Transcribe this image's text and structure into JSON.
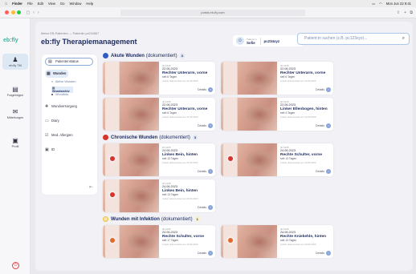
{
  "menubar": {
    "items": [
      "Finder",
      "File",
      "Edit",
      "View",
      "Go",
      "Window",
      "Help"
    ],
    "clock": "Mon Jun 22  9:41"
  },
  "browser": {
    "url": "portal.eb-fly.com"
  },
  "rail": {
    "logo_main": "eb:fly",
    "items": [
      {
        "label": "eb:fly TM"
      },
      {
        "label": "Fragebögen"
      },
      {
        "label": "Mitteilungen"
      },
      {
        "label": "Profil"
      }
    ]
  },
  "header": {
    "breadcrumb": "Meine EB-Patienten  →  Patientin pc234567",
    "title": "eb:fly Therapiemanagement",
    "user_caption": "Patient:in",
    "user_name": "Sofie",
    "user_id": "pc234xyz",
    "search_placeholder": "Patient:in suchen (z.B. pc123xyz)..."
  },
  "panel": {
    "status": "Patientenstatus",
    "wunden": "Wunden",
    "sub1": "Aktive Wunden",
    "sub2": "Wundarchiv",
    "sub3": "Wundfoto",
    "versorgung": "Wundversorgung",
    "diary": "Diary",
    "allergien": "Med. Allergien",
    "id": "ID"
  },
  "sections": {
    "akute": {
      "label": "Akute Wunden",
      "sub": "(dokumentiert)",
      "count": "3"
    },
    "chronische": {
      "label": "Chronische Wunden",
      "sub": "(dokumentiert)",
      "count": "3"
    },
    "infektion": {
      "label": "Wunden mit Infektion",
      "sub": "(dokumentiert)",
      "count": "1"
    }
  },
  "cards": [
    {
      "id": "ID 1235",
      "date": "22.06.2023",
      "loc": "Rechter Unterarm, vorne",
      "since": "seit 6 Tagen",
      "doc": "zuletzt dokumentiert am 22.06.2023",
      "details": "Details"
    },
    {
      "id": "ID 1235",
      "date": "22.06.2023",
      "loc": "Rechter Unterarm, vorne",
      "since": "seit 6 Tagen",
      "doc": "zuletzt dokumentiert am 22.06.2023",
      "details": "Details"
    },
    {
      "id": "ID 1235",
      "date": "22.06.2023",
      "loc": "Rechter Unterarm, vorne",
      "since": "seit 6 Tagen",
      "doc": "zuletzt dokumentiert am 22.06.2023",
      "details": "Details"
    },
    {
      "id": "ID 1235",
      "date": "22.06.2023",
      "loc": "Linker Ellenbogen, hinten",
      "since": "seit 4 Tagen",
      "doc": "zuletzt dokumentiert am 22.06.2023",
      "details": "Details"
    },
    {
      "id": "ID 1235",
      "date": "24.06.2023",
      "loc": "Linkes Bein, hinten",
      "since": "seit 13 Tagen",
      "doc": "zuletzt dokumentiert am 20.06.2023",
      "details": "Details"
    },
    {
      "id": "ID 1235",
      "date": "24.06.2023",
      "loc": "Rechte Schulter, vorne",
      "since": "seit 13 Tagen",
      "doc": "zuletzt dokumentiert am 20.06.2023",
      "details": "Details"
    },
    {
      "id": "ID 1235",
      "date": "24.06.2023",
      "loc": "Linkes Bein, hinten",
      "since": "seit 13 Tagen",
      "doc": "zuletzt dokumentiert am 20.06.2023",
      "details": "Details"
    },
    {
      "id": "ID 1235",
      "date": "24.06.2023",
      "loc": "Rechte Schulter, vorne",
      "since": "seit 17 Tagen",
      "doc": "zuletzt dokumentiert am 20.06.2023",
      "details": "Details"
    },
    {
      "id": "ID 1235",
      "date": "24.06.2023",
      "loc": "Rechte Kniekehle, hinten",
      "since": "seit 13 Tagen",
      "doc": "zuletzt dokumentiert am 20.06.2023",
      "details": "Details"
    }
  ],
  "colors": {
    "brand": "#1d2a5c",
    "accent": "#3bb4a0",
    "acute": "#2c5cc4",
    "chronic": "#d8332a",
    "infection": "#f0c040"
  }
}
